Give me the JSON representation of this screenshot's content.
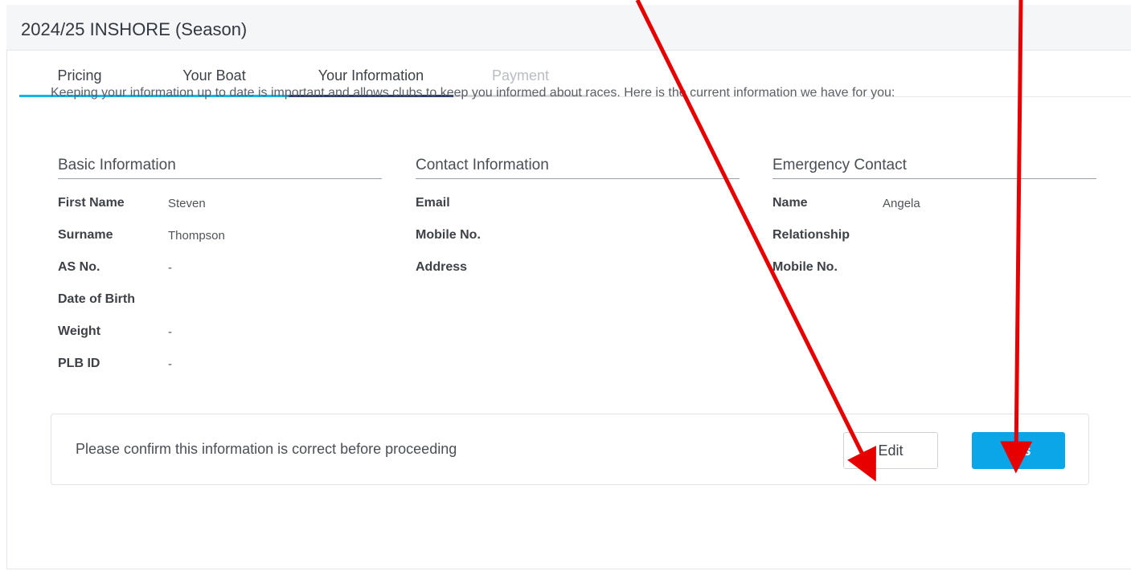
{
  "page": {
    "title": "2024/25 INSHORE (Season)"
  },
  "tabs": [
    {
      "label": "Pricing",
      "state": "done"
    },
    {
      "label": "Your Boat",
      "state": "done"
    },
    {
      "label": "Your Information",
      "state": "active"
    },
    {
      "label": "Payment",
      "state": "disabled"
    }
  ],
  "intro": "Keeping your information up to date is important and allows clubs to keep you informed about races. Here is the current information we have for you:",
  "basic": {
    "heading": "Basic Information",
    "fields": [
      {
        "label": "First Name",
        "value": "Steven"
      },
      {
        "label": "Surname",
        "value": "Thompson"
      },
      {
        "label": "AS No.",
        "value": "-"
      },
      {
        "label": "Date of Birth",
        "value": ""
      },
      {
        "label": "Weight",
        "value": "-"
      },
      {
        "label": "PLB ID",
        "value": "-"
      }
    ]
  },
  "contact": {
    "heading": "Contact Information",
    "fields": [
      {
        "label": "Email",
        "value": ""
      },
      {
        "label": "Mobile No.",
        "value": ""
      },
      {
        "label": "Address",
        "value": ""
      }
    ]
  },
  "emergency": {
    "heading": "Emergency Contact",
    "fields": [
      {
        "label": "Name",
        "value": "Angela"
      },
      {
        "label": "Relationship",
        "value": ""
      },
      {
        "label": "Mobile No.",
        "value": ""
      }
    ]
  },
  "confirm": {
    "message": "Please confirm this information is correct before proceeding",
    "edit_label": "Edit",
    "yes_label": "Yes"
  },
  "colors": {
    "accent": "#0aa6e8",
    "tab_done": "#14b6ea",
    "tab_active": "#2e3c6b",
    "annotation_arrow": "#e60000"
  }
}
